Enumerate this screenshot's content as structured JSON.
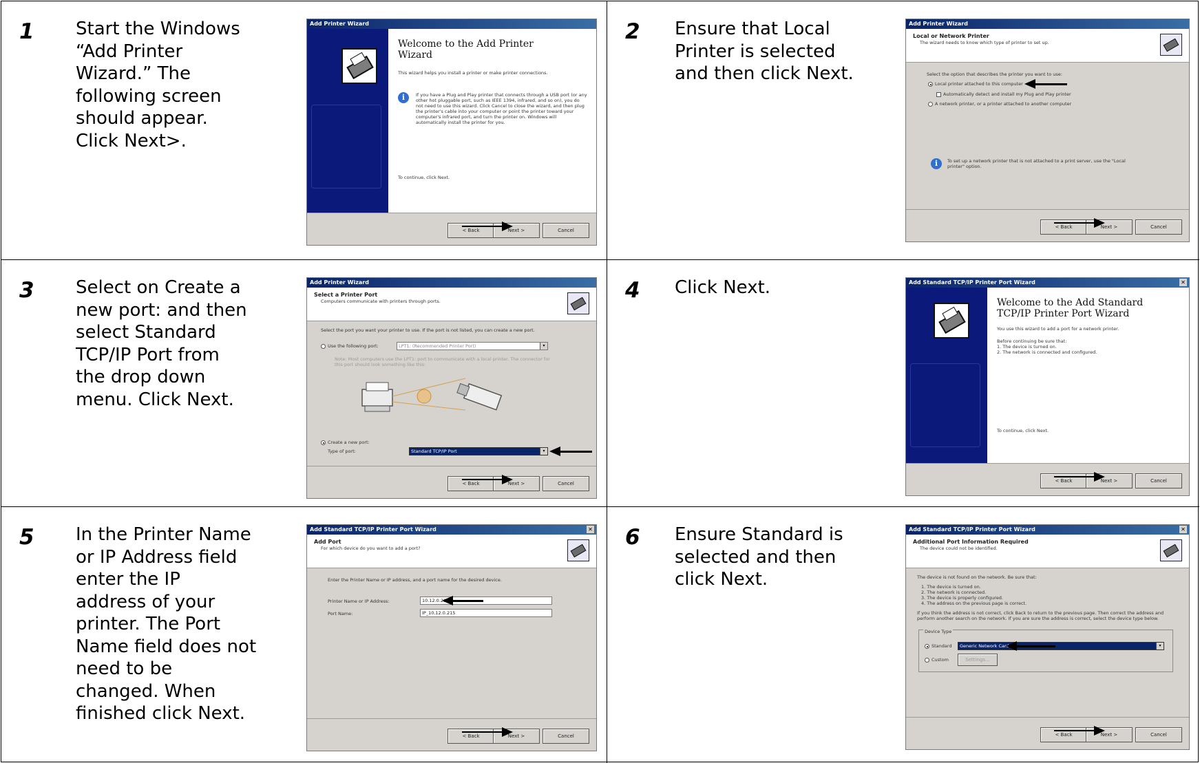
{
  "steps": [
    {
      "number": "1",
      "text": "Start the Windows\n“Add Printer\nWizard.” The\nfollowing screen\nshould appear.\nClick Next>."
    },
    {
      "number": "2",
      "text": "Ensure that Local\nPrinter is selected\nand then click Next."
    },
    {
      "number": "3",
      "text": "Select on Create a\nnew port: and then\nselect Standard\nTCP/IP Port from\nthe drop down\nmenu. Click Next."
    },
    {
      "number": "4",
      "text": "Click Next."
    },
    {
      "number": "5",
      "text": "In the Printer Name\nor IP Address field\nenter the IP\naddress of your\nprinter. The Port\nName field does not\nneed to be\nchanged. When\nfinished click Next."
    },
    {
      "number": "6",
      "text": "Ensure Standard is\nselected and then\nclick Next."
    }
  ],
  "dialogs": {
    "d1": {
      "title": "Add Printer Wizard",
      "heading": "Welcome to the Add Printer Wizard",
      "intro": "This wizard helps you install a printer or make printer connections.",
      "info": "If you have a Plug and Play printer that connects through a USB port (or any other hot pluggable port, such as IEEE 1394, infrared, and so on), you do not need to use this wizard. Click Cancel to close the wizard, and then plug the printer's cable into your computer or point the printer toward your computer's infrared port, and turn the printer on. Windows will automatically install the printer for you.",
      "continue": "To continue, click Next.",
      "back": "< Back",
      "next": "Next >",
      "cancel": "Cancel"
    },
    "d2": {
      "title": "Add Printer Wizard",
      "header_title": "Local or Network Printer",
      "header_sub": "The wizard needs to know which type of printer to set up.",
      "prompt": "Select the option that describes the printer you want to use:",
      "opt_local": "Local printer attached to this computer",
      "opt_auto": "Automatically detect and install my Plug and Play printer",
      "opt_network": "A network printer, or a printer attached to another computer",
      "info": "To set up a network printer that is not attached to a print server, use the \"Local printer\" option.",
      "back": "< Back",
      "next": "Next >",
      "cancel": "Cancel"
    },
    "d3": {
      "title": "Add Printer Wizard",
      "header_title": "Select a Printer Port",
      "header_sub": "Computers communicate with printers through ports.",
      "prompt": "Select the port you want your printer to use. If the port is not listed, you can create a new port.",
      "opt_use": "Use the following port:",
      "use_value": "LPT1: (Recommended Printer Port)",
      "note": "Note: Most computers use the LPT1: port to communicate with a local printer. The connector for this port should look something like this:",
      "opt_create": "Create a new port:",
      "type_label": "Type of port:",
      "type_value": "Standard TCP/IP Port",
      "back": "< Back",
      "next": "Next >",
      "cancel": "Cancel"
    },
    "d4": {
      "title": "Add Standard TCP/IP Printer Port Wizard",
      "heading": "Welcome to the Add Standard TCP/IP Printer Port Wizard",
      "intro": "You use this wizard to add a port for a network printer.",
      "before": "Before continuing be sure that:",
      "item1": "1.  The device is turned on.",
      "item2": "2.  The network is connected and configured.",
      "continue": "To continue, click Next.",
      "back": "< Back",
      "next": "Next >",
      "cancel": "Cancel"
    },
    "d5": {
      "title": "Add Standard TCP/IP Printer Port Wizard",
      "header_title": "Add Port",
      "header_sub": "For which device do you want to add a port?",
      "prompt": "Enter the Printer Name or IP address, and a port name for the desired device.",
      "ip_label": "Printer Name or IP Address:",
      "ip_value": "10.12.0.215",
      "port_label": "Port Name:",
      "port_value": "IP_10.12.0.215",
      "back": "< Back",
      "next": "Next >",
      "cancel": "Cancel"
    },
    "d6": {
      "title": "Add Standard TCP/IP Printer Port Wizard",
      "header_title": "Additional Port Information Required",
      "header_sub": "The device could not be identified.",
      "prompt": "The device is not found on the network. Be sure that:",
      "item1": "1.  The device is turned on.",
      "item2": "2.  The network is connected.",
      "item3": "3.  The device is properly configured.",
      "item4": "4.  The address on the previous page is correct.",
      "para": "If you think the address is not correct, click Back to return to the previous page. Then correct the address and perform another search on the network. If you are sure the address is correct, select the device type below.",
      "group_label": "Device Type",
      "opt_standard": "Standard",
      "standard_value": "Generic Network Card",
      "opt_custom": "Custom",
      "settings": "Settings...",
      "back": "< Back",
      "next": "Next >",
      "cancel": "Cancel"
    }
  }
}
